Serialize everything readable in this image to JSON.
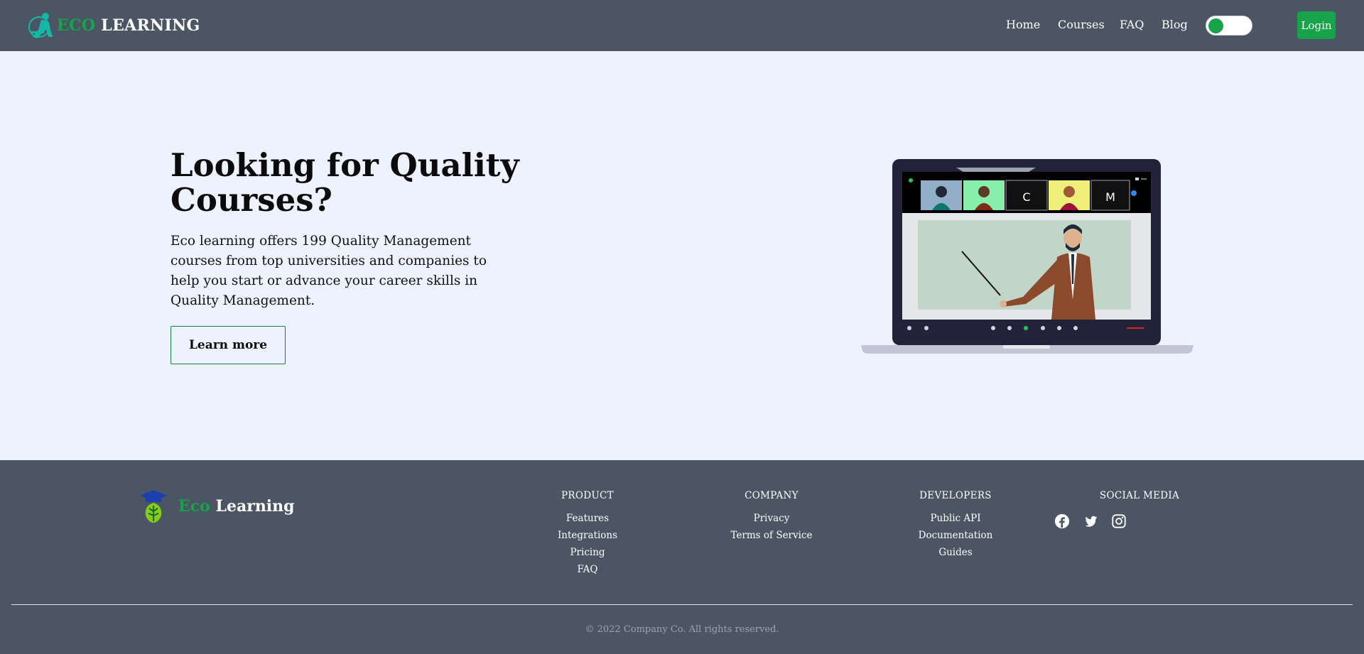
{
  "nav": {
    "brand_eco": "ECO",
    "brand_rest": " LEARNING",
    "links": [
      "Home",
      "Courses",
      "FAQ",
      "Blog"
    ],
    "login_label": "Login",
    "toggle_state": "on"
  },
  "hero": {
    "title": "Looking for Quality Courses?",
    "description": "Eco learning offers 199 Quality Management courses from top universities and companies to help you start or advance your career skills in Quality Management.",
    "button_label": "Learn more",
    "illustration_tiles": [
      "C",
      "M"
    ]
  },
  "footer": {
    "brand_eco": "Eco",
    "brand_rest": " Learning",
    "columns": [
      {
        "title": "PRODUCT",
        "links": [
          "Features",
          "Integrations",
          "Pricing",
          "FAQ"
        ]
      },
      {
        "title": "COMPANY",
        "links": [
          "Privacy",
          "Terms of Service"
        ]
      },
      {
        "title": "DEVELOPERS",
        "links": [
          "Public API",
          "Documentation",
          "Guides"
        ]
      },
      {
        "title": "SOCIAL MEDIA",
        "icons": [
          "facebook-icon",
          "twitter-icon",
          "instagram-icon"
        ]
      }
    ],
    "copyright": "© 2022 Company Co. All rights reserved."
  },
  "colors": {
    "nav_bg": "#4b5563",
    "accent": "#16a34a",
    "hero_bg": "#eef2ff"
  }
}
